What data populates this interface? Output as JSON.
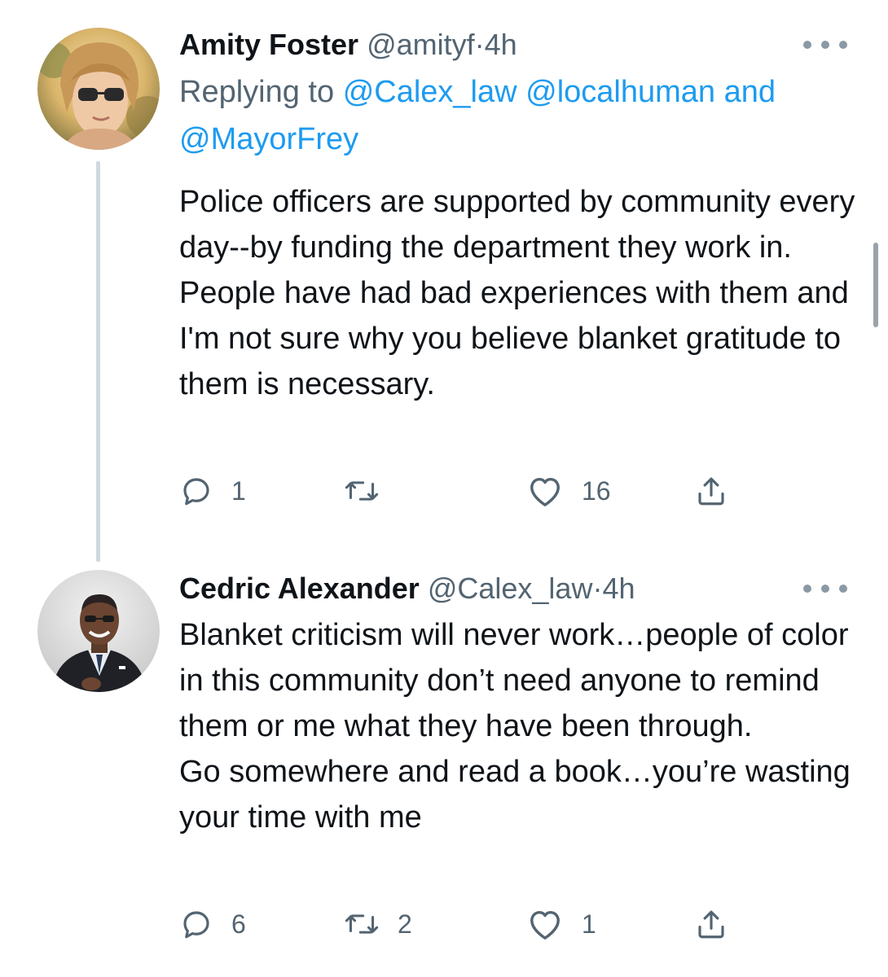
{
  "tweets": [
    {
      "name": "Amity Foster",
      "handle": "@amityf",
      "separator": "·",
      "time": "4h",
      "replying_prefix": "Replying to",
      "replying_mentions": [
        "@Calex_law",
        "@localhuman"
      ],
      "replying_conjunction": "and",
      "replying_last": "@MayorFrey",
      "body": [
        "Police officers are supported by community every day--by funding the department they work in. People have had bad experiences with them and I'm not sure why you believe blanket gratitude to them is necessary."
      ],
      "actions": {
        "reply_count": "1",
        "retweet_count": "",
        "like_count": "16"
      }
    },
    {
      "name": "Cedric Alexander",
      "handle": "@Calex_law",
      "separator": "·",
      "time": "4h",
      "body": [
        "Blanket criticism will never work…people of color in this community don’t need anyone to remind them or me what they have been through.",
        "Go somewhere and read a book…you’re wasting your time with me"
      ],
      "actions": {
        "reply_count": "6",
        "retweet_count": "2",
        "like_count": "1"
      }
    }
  ],
  "icons": {
    "reply": "reply-icon",
    "retweet": "retweet-icon",
    "like": "heart-icon",
    "share": "share-icon",
    "more": "more-options-icon"
  },
  "colors": {
    "link": "#1d9bf0",
    "secondary_text": "#536471",
    "primary_text": "#0f1419",
    "thread_line": "#cfd9de"
  }
}
